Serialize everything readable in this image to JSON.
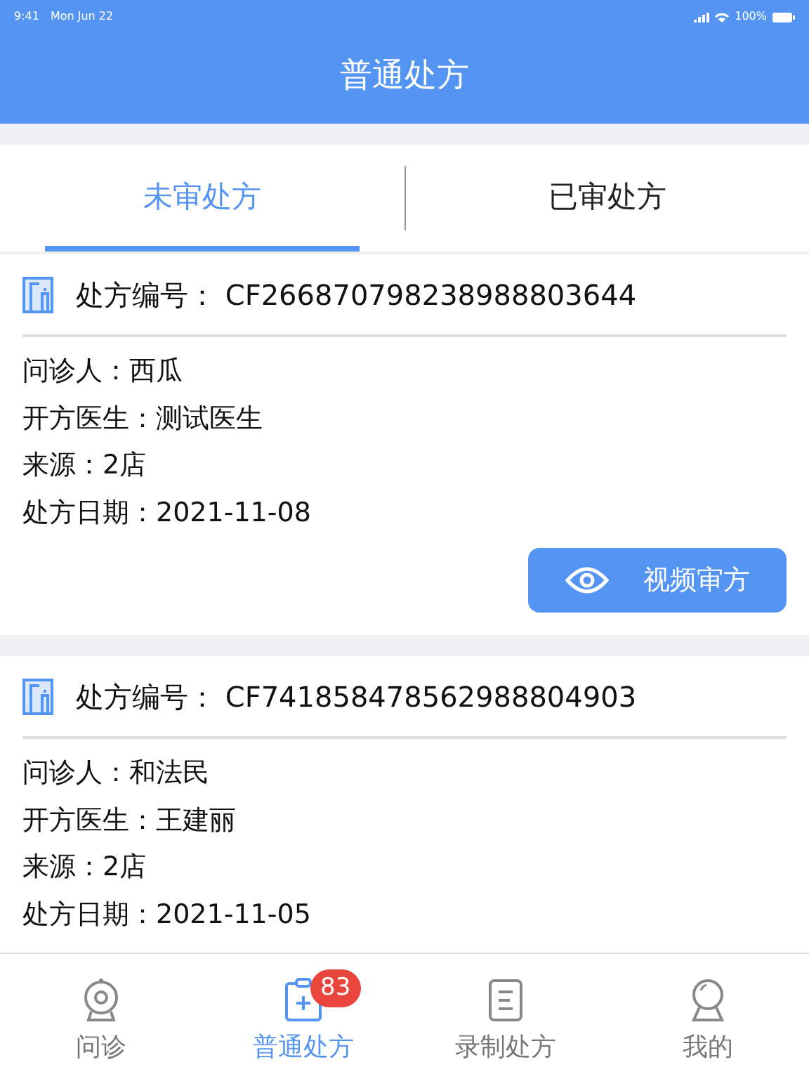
{
  "status_bar": {
    "time": "9:41",
    "date": "Mon Jun 22",
    "battery": "100%"
  },
  "header": {
    "title": "普通处方"
  },
  "tabs": [
    {
      "label": "未审处方",
      "selected": true
    },
    {
      "label": "已审处方",
      "selected": false
    }
  ],
  "prescriptions": [
    {
      "number": "处方编号： CF266870798238988803644",
      "lines": [
        "问诊人：西瓜",
        "开方医生：测试医生",
        "来源：2店",
        "处方日期：2021-11-08"
      ],
      "button": "视频审方"
    },
    {
      "number": "处方编号： CF741858478562988804903",
      "lines": [
        "问诊人：和法民",
        "开方医生：王建丽",
        "来源：2店",
        "处方日期：2021-11-05"
      ]
    }
  ],
  "tab_bar": [
    {
      "label": "问诊",
      "kind": "camera",
      "selected": false
    },
    {
      "label": "普通处方",
      "kind": "clipboard",
      "selected": true,
      "badge": "83"
    },
    {
      "label": "录制处方",
      "kind": "document",
      "selected": false
    },
    {
      "label": "我的",
      "kind": "person",
      "selected": false
    }
  ]
}
